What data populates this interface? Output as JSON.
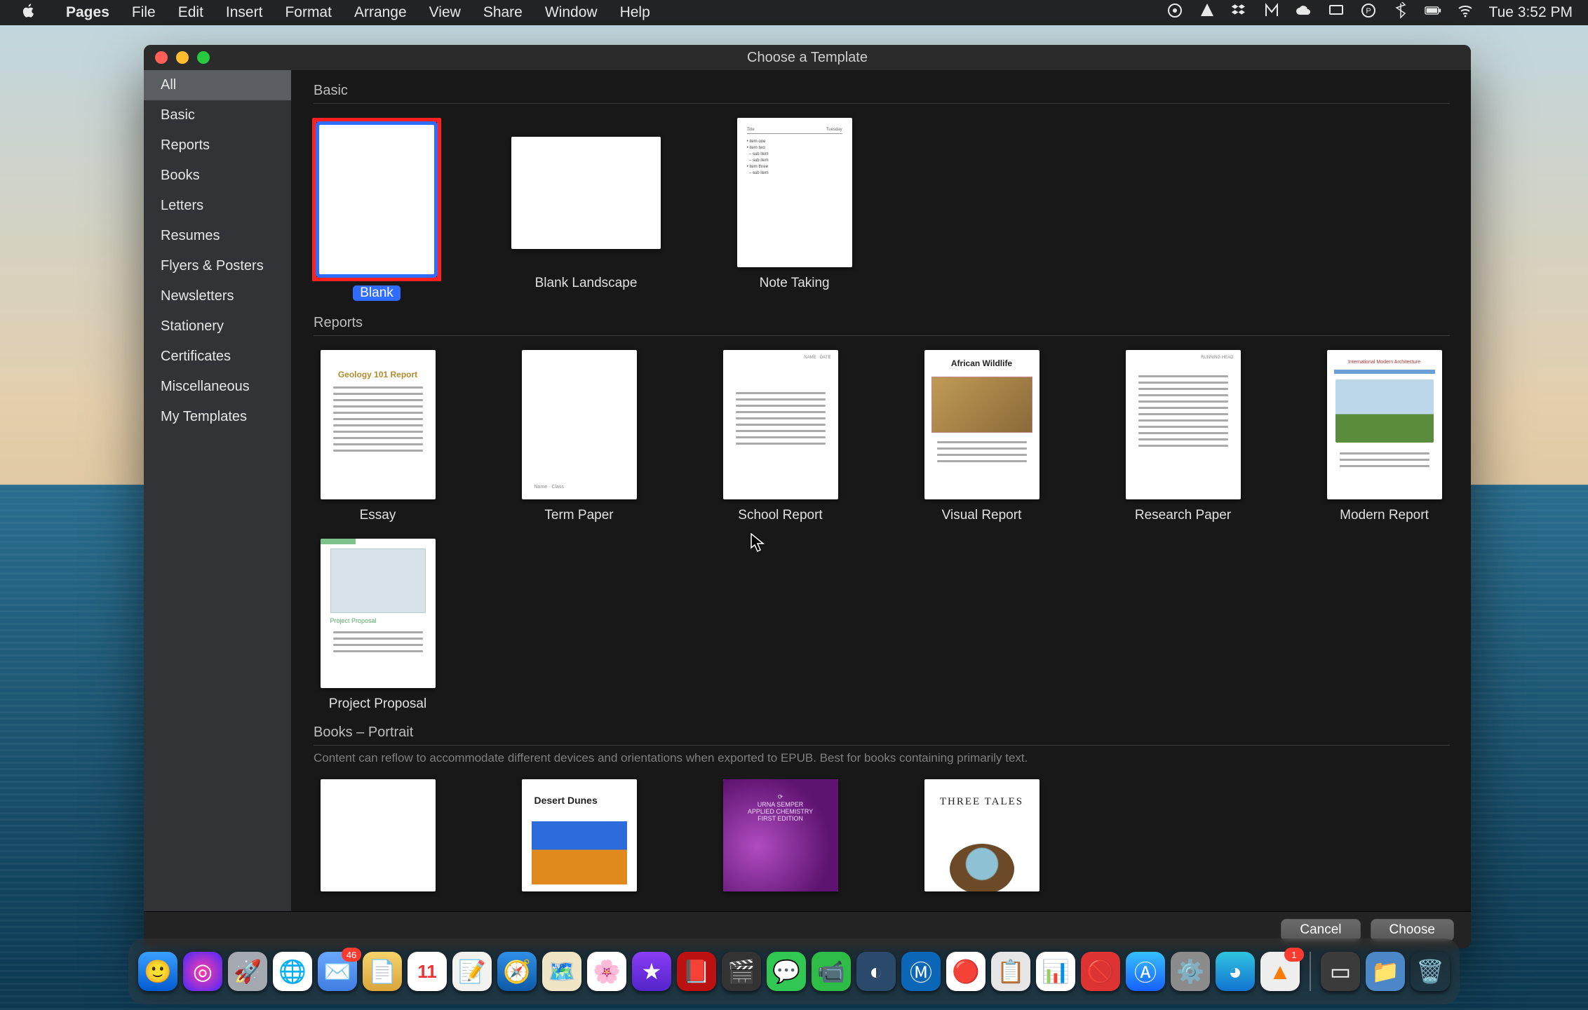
{
  "menubar": {
    "app_name": "Pages",
    "menus": [
      "File",
      "Edit",
      "Insert",
      "Format",
      "Arrange",
      "View",
      "Share",
      "Window",
      "Help"
    ],
    "clock": "Tue 3:52 PM"
  },
  "window": {
    "title": "Choose a Template",
    "sidebar_items": [
      "All",
      "Basic",
      "Reports",
      "Books",
      "Letters",
      "Resumes",
      "Flyers & Posters",
      "Newsletters",
      "Stationery",
      "Certificates",
      "Miscellaneous",
      "My Templates"
    ],
    "sidebar_selected_index": 0,
    "footer": {
      "cancel": "Cancel",
      "choose": "Choose"
    }
  },
  "sections": {
    "basic": {
      "title": "Basic",
      "templates": [
        "Blank",
        "Blank Landscape",
        "Note Taking"
      ],
      "selected_index": 0
    },
    "reports": {
      "title": "Reports",
      "templates": [
        "Essay",
        "Term Paper",
        "School Report",
        "Visual Report",
        "Research Paper",
        "Modern Report",
        "Project Proposal"
      ]
    },
    "books": {
      "title": "Books – Portrait",
      "subtitle": "Content can reflow to accommodate different devices and orientations when exported to EPUB. Best for books containing primarily text.",
      "templates_visible": [
        "",
        "Desert Dunes",
        "Applied Chemistry",
        "Three Tales"
      ]
    }
  },
  "previews": {
    "essay_title": "Geology 101 Report",
    "visual_title": "African Wildlife",
    "desert_title": "Desert Dunes",
    "tales_title": "THREE TALES",
    "modern_title": "International Modern Architecture"
  },
  "dock_apps": [
    {
      "name": "finder",
      "bg": "linear-gradient(#3aa0ff,#005bd1)",
      "glyph": "🙂",
      "badge": null
    },
    {
      "name": "siri",
      "bg": "radial-gradient(circle,#ff3da6,#4428ff)",
      "glyph": "◎",
      "badge": null
    },
    {
      "name": "launchpad",
      "bg": "#a4a8b0",
      "glyph": "🚀",
      "badge": null
    },
    {
      "name": "chrome",
      "bg": "#fff",
      "glyph": "🌐",
      "badge": null
    },
    {
      "name": "mail",
      "bg": "linear-gradient(#6aa8ff,#3f7ee0)",
      "glyph": "✉️",
      "badge": "46"
    },
    {
      "name": "notes",
      "bg": "linear-gradient(#f6d26b,#dba53a)",
      "glyph": "📄",
      "badge": null
    },
    {
      "name": "calendar",
      "bg": "#fff",
      "glyph": "11",
      "badge": null
    },
    {
      "name": "textedit",
      "bg": "#f2f2ee",
      "glyph": "📝",
      "badge": null
    },
    {
      "name": "safari",
      "bg": "linear-gradient(#2f8fe8,#0e5aa7)",
      "glyph": "🧭",
      "badge": null
    },
    {
      "name": "maps",
      "bg": "#f0e6c6",
      "glyph": "🗺️",
      "badge": null
    },
    {
      "name": "photos",
      "bg": "#fff",
      "glyph": "🌸",
      "badge": null
    },
    {
      "name": "imovie-star",
      "bg": "linear-gradient(#8a3cf7,#5324c9)",
      "glyph": "★",
      "badge": null
    },
    {
      "name": "acrobat",
      "bg": "#b11",
      "glyph": "📕",
      "badge": null
    },
    {
      "name": "imovie",
      "bg": "#333",
      "glyph": "🎬",
      "badge": null
    },
    {
      "name": "messages",
      "bg": "#30c852",
      "glyph": "💬",
      "badge": null
    },
    {
      "name": "facetime",
      "bg": "#2dbd46",
      "glyph": "📹",
      "badge": null
    },
    {
      "name": "steam",
      "bg": "#2b4a6b",
      "glyph": "◐",
      "badge": null
    },
    {
      "name": "malwarebytes",
      "bg": "#0b66b7",
      "glyph": "Ⓜ",
      "badge": null
    },
    {
      "name": "record",
      "bg": "#fff",
      "glyph": "🔴",
      "badge": null
    },
    {
      "name": "office",
      "bg": "#e6e6e6",
      "glyph": "📋",
      "badge": null
    },
    {
      "name": "numbers",
      "bg": "#fff",
      "glyph": "📊",
      "badge": null
    },
    {
      "name": "block",
      "bg": "#d33",
      "glyph": "🚫",
      "badge": null
    },
    {
      "name": "appstore",
      "bg": "linear-gradient(#35c0ff,#1860ff)",
      "glyph": "Ⓐ",
      "badge": null
    },
    {
      "name": "settings",
      "bg": "#8b8b8b",
      "glyph": "⚙️",
      "badge": null
    },
    {
      "name": "edge",
      "bg": "linear-gradient(#30c4e0,#1273d0)",
      "glyph": "◕",
      "badge": null
    },
    {
      "name": "vlc",
      "bg": "#eee",
      "glyph": "▲",
      "badge": "1"
    },
    {
      "name": "sep",
      "sep": true
    },
    {
      "name": "window",
      "bg": "#3b3b3b",
      "glyph": "▭",
      "badge": null
    },
    {
      "name": "folder",
      "bg": "#4c88c8",
      "glyph": "📁",
      "badge": null
    },
    {
      "name": "trash",
      "bg": "transparent",
      "glyph": "🗑️",
      "badge": null
    }
  ]
}
